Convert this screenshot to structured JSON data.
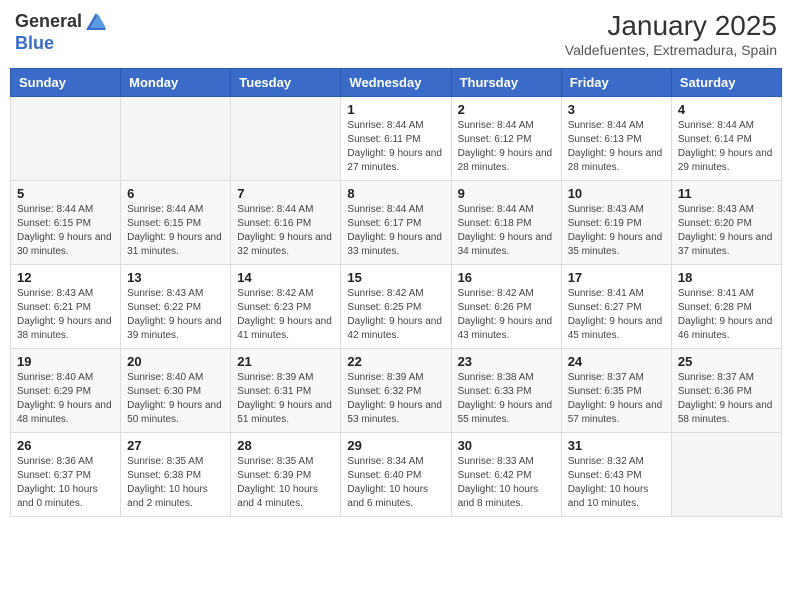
{
  "logo": {
    "general": "General",
    "blue": "Blue"
  },
  "header": {
    "month": "January 2025",
    "location": "Valdefuentes, Extremadura, Spain"
  },
  "weekdays": [
    "Sunday",
    "Monday",
    "Tuesday",
    "Wednesday",
    "Thursday",
    "Friday",
    "Saturday"
  ],
  "weeks": [
    [
      {
        "day": "",
        "info": ""
      },
      {
        "day": "",
        "info": ""
      },
      {
        "day": "",
        "info": ""
      },
      {
        "day": "1",
        "info": "Sunrise: 8:44 AM\nSunset: 6:11 PM\nDaylight: 9 hours and 27 minutes."
      },
      {
        "day": "2",
        "info": "Sunrise: 8:44 AM\nSunset: 6:12 PM\nDaylight: 9 hours and 28 minutes."
      },
      {
        "day": "3",
        "info": "Sunrise: 8:44 AM\nSunset: 6:13 PM\nDaylight: 9 hours and 28 minutes."
      },
      {
        "day": "4",
        "info": "Sunrise: 8:44 AM\nSunset: 6:14 PM\nDaylight: 9 hours and 29 minutes."
      }
    ],
    [
      {
        "day": "5",
        "info": "Sunrise: 8:44 AM\nSunset: 6:15 PM\nDaylight: 9 hours and 30 minutes."
      },
      {
        "day": "6",
        "info": "Sunrise: 8:44 AM\nSunset: 6:15 PM\nDaylight: 9 hours and 31 minutes."
      },
      {
        "day": "7",
        "info": "Sunrise: 8:44 AM\nSunset: 6:16 PM\nDaylight: 9 hours and 32 minutes."
      },
      {
        "day": "8",
        "info": "Sunrise: 8:44 AM\nSunset: 6:17 PM\nDaylight: 9 hours and 33 minutes."
      },
      {
        "day": "9",
        "info": "Sunrise: 8:44 AM\nSunset: 6:18 PM\nDaylight: 9 hours and 34 minutes."
      },
      {
        "day": "10",
        "info": "Sunrise: 8:43 AM\nSunset: 6:19 PM\nDaylight: 9 hours and 35 minutes."
      },
      {
        "day": "11",
        "info": "Sunrise: 8:43 AM\nSunset: 6:20 PM\nDaylight: 9 hours and 37 minutes."
      }
    ],
    [
      {
        "day": "12",
        "info": "Sunrise: 8:43 AM\nSunset: 6:21 PM\nDaylight: 9 hours and 38 minutes."
      },
      {
        "day": "13",
        "info": "Sunrise: 8:43 AM\nSunset: 6:22 PM\nDaylight: 9 hours and 39 minutes."
      },
      {
        "day": "14",
        "info": "Sunrise: 8:42 AM\nSunset: 6:23 PM\nDaylight: 9 hours and 41 minutes."
      },
      {
        "day": "15",
        "info": "Sunrise: 8:42 AM\nSunset: 6:25 PM\nDaylight: 9 hours and 42 minutes."
      },
      {
        "day": "16",
        "info": "Sunrise: 8:42 AM\nSunset: 6:26 PM\nDaylight: 9 hours and 43 minutes."
      },
      {
        "day": "17",
        "info": "Sunrise: 8:41 AM\nSunset: 6:27 PM\nDaylight: 9 hours and 45 minutes."
      },
      {
        "day": "18",
        "info": "Sunrise: 8:41 AM\nSunset: 6:28 PM\nDaylight: 9 hours and 46 minutes."
      }
    ],
    [
      {
        "day": "19",
        "info": "Sunrise: 8:40 AM\nSunset: 6:29 PM\nDaylight: 9 hours and 48 minutes."
      },
      {
        "day": "20",
        "info": "Sunrise: 8:40 AM\nSunset: 6:30 PM\nDaylight: 9 hours and 50 minutes."
      },
      {
        "day": "21",
        "info": "Sunrise: 8:39 AM\nSunset: 6:31 PM\nDaylight: 9 hours and 51 minutes."
      },
      {
        "day": "22",
        "info": "Sunrise: 8:39 AM\nSunset: 6:32 PM\nDaylight: 9 hours and 53 minutes."
      },
      {
        "day": "23",
        "info": "Sunrise: 8:38 AM\nSunset: 6:33 PM\nDaylight: 9 hours and 55 minutes."
      },
      {
        "day": "24",
        "info": "Sunrise: 8:37 AM\nSunset: 6:35 PM\nDaylight: 9 hours and 57 minutes."
      },
      {
        "day": "25",
        "info": "Sunrise: 8:37 AM\nSunset: 6:36 PM\nDaylight: 9 hours and 58 minutes."
      }
    ],
    [
      {
        "day": "26",
        "info": "Sunrise: 8:36 AM\nSunset: 6:37 PM\nDaylight: 10 hours and 0 minutes."
      },
      {
        "day": "27",
        "info": "Sunrise: 8:35 AM\nSunset: 6:38 PM\nDaylight: 10 hours and 2 minutes."
      },
      {
        "day": "28",
        "info": "Sunrise: 8:35 AM\nSunset: 6:39 PM\nDaylight: 10 hours and 4 minutes."
      },
      {
        "day": "29",
        "info": "Sunrise: 8:34 AM\nSunset: 6:40 PM\nDaylight: 10 hours and 6 minutes."
      },
      {
        "day": "30",
        "info": "Sunrise: 8:33 AM\nSunset: 6:42 PM\nDaylight: 10 hours and 8 minutes."
      },
      {
        "day": "31",
        "info": "Sunrise: 8:32 AM\nSunset: 6:43 PM\nDaylight: 10 hours and 10 minutes."
      },
      {
        "day": "",
        "info": ""
      }
    ]
  ]
}
